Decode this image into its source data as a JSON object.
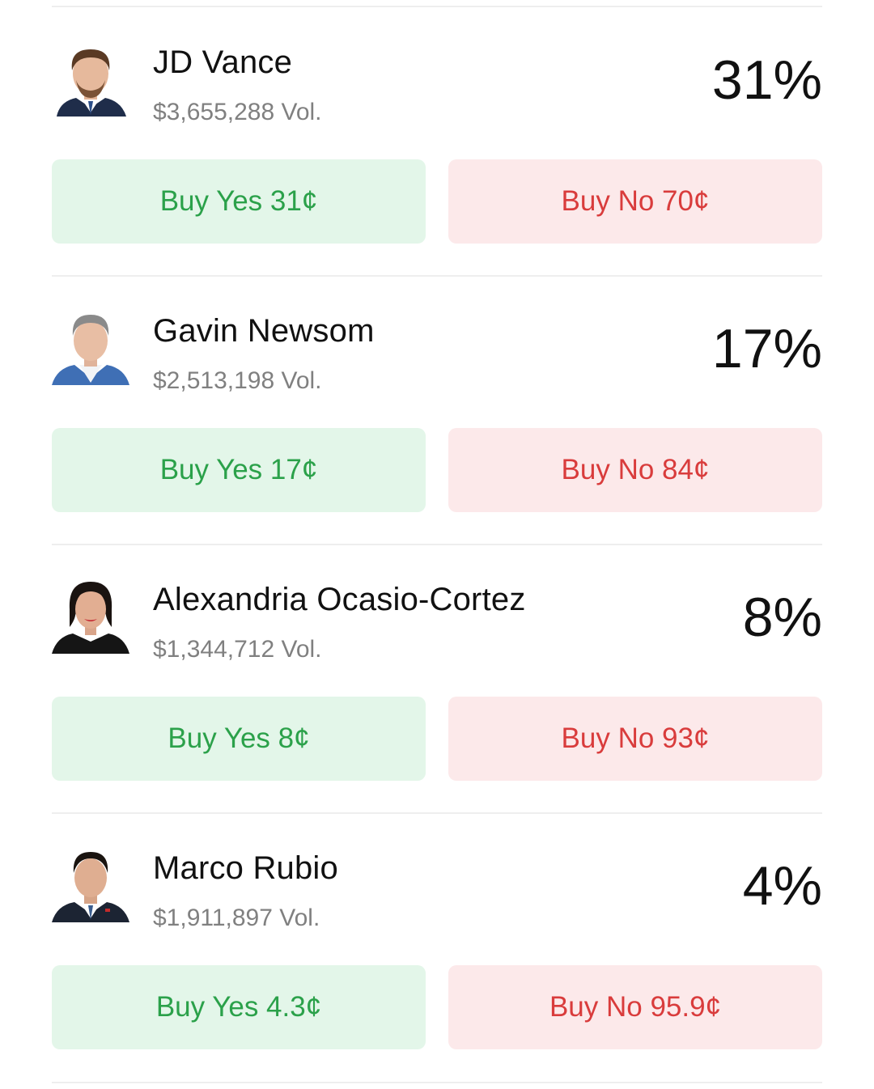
{
  "colors": {
    "yes_bg": "#e3f6e9",
    "yes_text": "#2ba14a",
    "no_bg": "#fce9ea",
    "no_text": "#d93c3c",
    "divider": "#eeeeee"
  },
  "candidates": [
    {
      "name": "JD Vance",
      "volume": "$3,655,288 Vol.",
      "percent": "31%",
      "buy_yes": "Buy Yes 31¢",
      "buy_no": "Buy No 70¢",
      "avatar_icon": "jd-vance-portrait"
    },
    {
      "name": "Gavin Newsom",
      "volume": "$2,513,198 Vol.",
      "percent": "17%",
      "buy_yes": "Buy Yes 17¢",
      "buy_no": "Buy No 84¢",
      "avatar_icon": "gavin-newsom-portrait"
    },
    {
      "name": "Alexandria Ocasio-Cortez",
      "volume": "$1,344,712 Vol.",
      "percent": "8%",
      "buy_yes": "Buy Yes 8¢",
      "buy_no": "Buy No 93¢",
      "avatar_icon": "aoc-portrait"
    },
    {
      "name": "Marco Rubio",
      "volume": "$1,911,897 Vol.",
      "percent": "4%",
      "buy_yes": "Buy Yes 4.3¢",
      "buy_no": "Buy No 95.9¢",
      "avatar_icon": "marco-rubio-portrait"
    }
  ]
}
